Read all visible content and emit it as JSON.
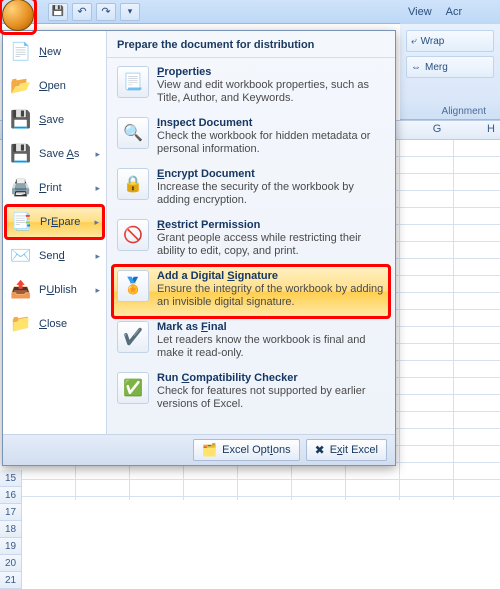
{
  "qat": {
    "buttons": [
      "save",
      "undo",
      "redo",
      "dd"
    ]
  },
  "ribbon": {
    "tabs": {
      "view": "View",
      "acrobat": "Acr"
    },
    "group_label": "Alignment",
    "btns": {
      "wrap": "Wrap",
      "merge": "Merg"
    }
  },
  "columns": {
    "g": "G",
    "h": "H"
  },
  "rows": [
    "15",
    "16",
    "17",
    "18",
    "19",
    "20",
    "21"
  ],
  "menu": {
    "header": "Prepare the document for distribution",
    "left": {
      "new": {
        "label": "New",
        "u": "N"
      },
      "open": {
        "label": "Open",
        "u": "O"
      },
      "save": {
        "label": "Save",
        "u": "S"
      },
      "saveas": {
        "label": "Save As",
        "u": "A"
      },
      "print": {
        "label": "Print",
        "u": "P"
      },
      "prepare": {
        "label": "Prepare",
        "u": "E"
      },
      "send": {
        "label": "Send",
        "u": "d"
      },
      "publish": {
        "label": "Publish",
        "u": "U"
      },
      "close": {
        "label": "Close",
        "u": "C"
      }
    },
    "right": {
      "properties": {
        "title": "Properties",
        "u": "P",
        "desc": "View and edit workbook properties, such as Title, Author, and Keywords."
      },
      "inspect": {
        "title": "Inspect Document",
        "u": "I",
        "desc": "Check the workbook for hidden metadata or personal information."
      },
      "encrypt": {
        "title": "Encrypt Document",
        "u": "E",
        "desc": "Increase the security of the workbook by adding encryption."
      },
      "restrict": {
        "title": "Restrict Permission",
        "u": "R",
        "desc": "Grant people access while restricting their ability to edit, copy, and print."
      },
      "signature": {
        "title": "Add a Digital Signature",
        "u": "S",
        "desc": "Ensure the integrity of the workbook by adding an invisible digital signature."
      },
      "final": {
        "title": "Mark as Final",
        "u": "F",
        "desc": "Let readers know the workbook is final and make it read-only."
      },
      "compat": {
        "title": "Run Compatibility Checker",
        "u": "C",
        "desc": "Check for features not supported by earlier versions of Excel."
      }
    },
    "footer": {
      "options": {
        "label": "Excel Options",
        "u": "I"
      },
      "exit": {
        "label": "Exit Excel",
        "u": "x"
      }
    }
  }
}
